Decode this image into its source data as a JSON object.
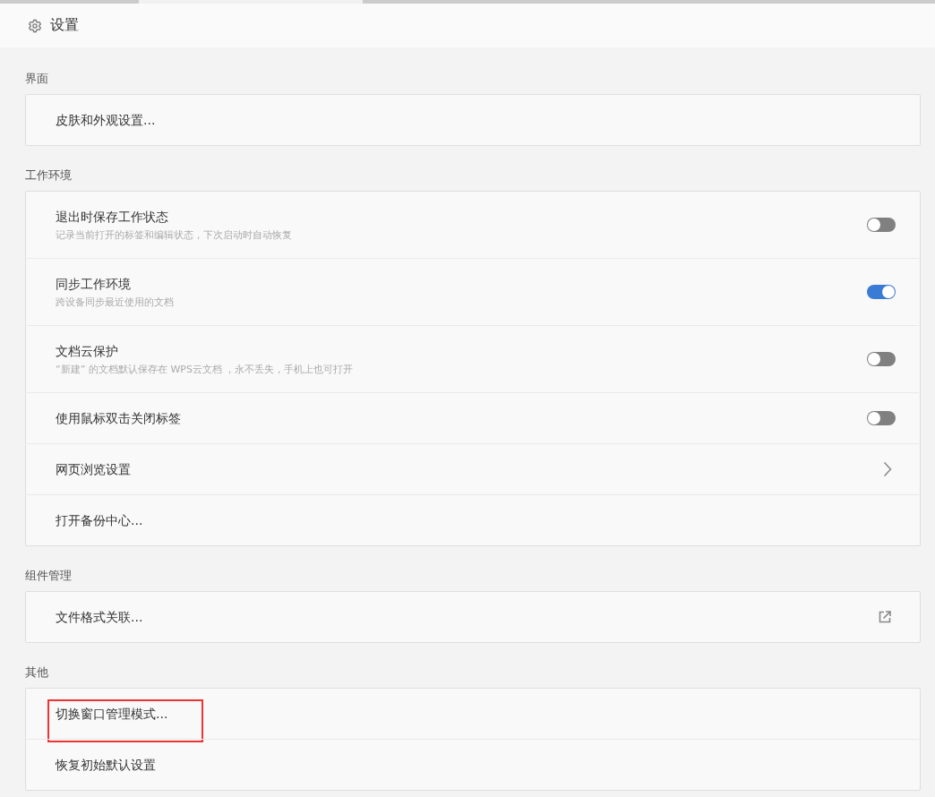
{
  "header": {
    "title": "设置"
  },
  "sections": [
    {
      "label": "界面",
      "items": [
        {
          "kind": "plain",
          "title": "皮肤和外观设置...",
          "annotated": false
        }
      ]
    },
    {
      "label": "工作环境",
      "items": [
        {
          "kind": "toggle",
          "title": "退出时保存工作状态",
          "subtitle": "记录当前打开的标签和编辑状态，下次启动时自动恢复",
          "on": false,
          "annotated": false
        },
        {
          "kind": "toggle",
          "title": "同步工作环境",
          "subtitle": "跨设备同步最近使用的文档",
          "on": true,
          "annotated": false
        },
        {
          "kind": "toggle",
          "title": "文档云保护",
          "subtitle": "“新建” 的文档默认保存在 WPS云文档 ，永不丢失，手机上也可打开",
          "on": false,
          "annotated": false
        },
        {
          "kind": "toggle",
          "title": "使用鼠标双击关闭标签",
          "on": false,
          "annotated": false
        },
        {
          "kind": "chevron",
          "title": "网页浏览设置",
          "annotated": false
        },
        {
          "kind": "plain",
          "title": "打开备份中心...",
          "annotated": false
        }
      ]
    },
    {
      "label": "组件管理",
      "items": [
        {
          "kind": "external",
          "title": "文件格式关联...",
          "annotated": false
        }
      ]
    },
    {
      "label": "其他",
      "items": [
        {
          "kind": "plain",
          "title": "切换窗口管理模式...",
          "annotated": true
        },
        {
          "kind": "plain",
          "title": "恢复初始默认设置",
          "annotated": false
        }
      ]
    }
  ]
}
